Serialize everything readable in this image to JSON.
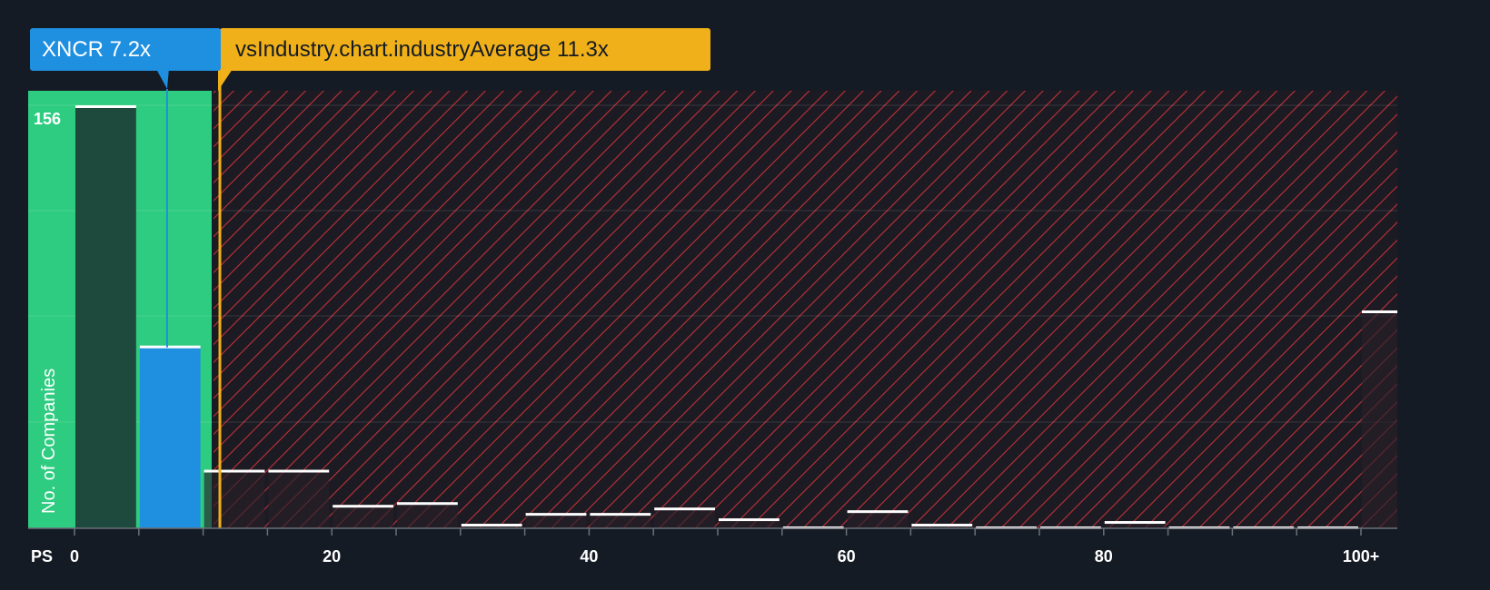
{
  "chart_data": {
    "type": "bar",
    "x_axis_label": "PS",
    "y_axis_label": "No. of Companies",
    "y_max_label": "156",
    "x_ticks": [
      "0",
      "20",
      "40",
      "60",
      "80",
      "100+"
    ],
    "x_tick_values": [
      0,
      20,
      40,
      60,
      80,
      100
    ],
    "bin_width": 5,
    "bins": [
      {
        "start": 0,
        "end": 5,
        "value": 156
      },
      {
        "start": 5,
        "end": 10,
        "value": 67
      },
      {
        "start": 10,
        "end": 15,
        "value": 21
      },
      {
        "start": 15,
        "end": 20,
        "value": 21
      },
      {
        "start": 20,
        "end": 25,
        "value": 8
      },
      {
        "start": 25,
        "end": 30,
        "value": 9
      },
      {
        "start": 30,
        "end": 35,
        "value": 1
      },
      {
        "start": 35,
        "end": 40,
        "value": 5
      },
      {
        "start": 40,
        "end": 45,
        "value": 5
      },
      {
        "start": 45,
        "end": 50,
        "value": 7
      },
      {
        "start": 50,
        "end": 55,
        "value": 3
      },
      {
        "start": 55,
        "end": 60,
        "value": 0
      },
      {
        "start": 60,
        "end": 65,
        "value": 6
      },
      {
        "start": 65,
        "end": 70,
        "value": 1
      },
      {
        "start": 70,
        "end": 75,
        "value": 0
      },
      {
        "start": 75,
        "end": 80,
        "value": 0
      },
      {
        "start": 80,
        "end": 85,
        "value": 2
      },
      {
        "start": 85,
        "end": 90,
        "value": 0
      },
      {
        "start": 90,
        "end": 95,
        "value": 0
      },
      {
        "start": 95,
        "end": 100,
        "value": 0
      },
      {
        "start": 100,
        "end": 105,
        "value": 80,
        "label": "100+"
      }
    ],
    "ylim": [
      0,
      160
    ],
    "company": {
      "ticker": "XNCR",
      "value": 7.2,
      "label": "XNCR 7.2x"
    },
    "industry_average": {
      "value": 11.3,
      "label": "vsIndustry.chart.industryAverage 11.3x"
    },
    "colors": {
      "background": "#151b24",
      "fair_zone": "#2ecc80",
      "company_bar": "#1f8fe0",
      "company_bin_bar": "#1d4a3c",
      "overvalued_hatch": "#c0323a",
      "industry_line": "#f0b019",
      "bar_cap": "#ffffff"
    }
  }
}
